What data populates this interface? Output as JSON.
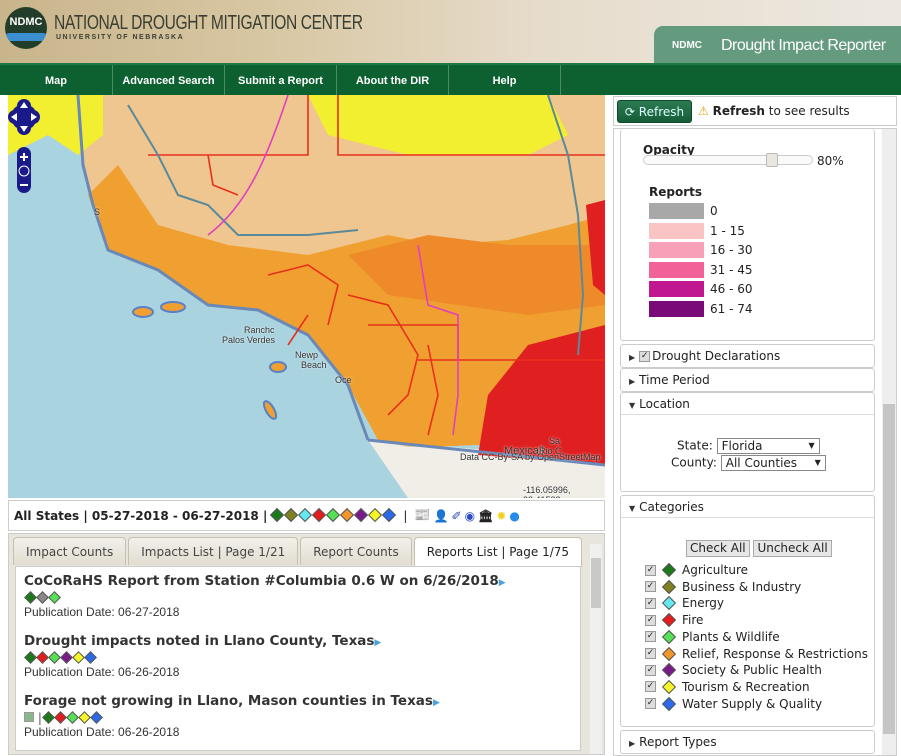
{
  "header": {
    "logo_text": "NDMC",
    "org_name": "NATIONAL DROUGHT MITIGATION CENTER",
    "university": "UNIVERSITY OF NEBRASKA",
    "app_short": "NDMC",
    "app_title": "Drought Impact Reporter"
  },
  "nav": [
    "Map",
    "Advanced Search",
    "Submit a Report",
    "About the DIR",
    "Help"
  ],
  "map": {
    "labels": {
      "ranchos": "Ranchc",
      "palos_verdes": "Palos Verdes",
      "newport": "Newp",
      "beach": "Beach",
      "oceanside": "Oce",
      "mexicali": "Mexicali",
      "rio": "Rio C",
      "san": "Sa",
      "s": "S"
    },
    "attribution": "Data CC-By-SA by OpenStreetMap",
    "coordinates": "-116.05996, 33.41588"
  },
  "filter": {
    "summary": "All States | 05-27-2018 - 06-27-2018 |",
    "category_colors": [
      "#1a7a1a",
      "#808020",
      "#66e8f0",
      "#e51c1c",
      "#55e055",
      "#f0962a",
      "#7a1a8a",
      "#f5f52a",
      "#2a6ae8"
    ],
    "separator": "|",
    "source_icons": [
      "news-icon",
      "person-icon",
      "cocorahs-icon",
      "noaa-icon",
      "government-icon",
      "sun-icon",
      "water-icon"
    ]
  },
  "tabs": [
    {
      "label": "Impact Counts"
    },
    {
      "label": "Impacts List | Page 1/21"
    },
    {
      "label": "Report Counts"
    },
    {
      "label": "Reports List | Page 1/75",
      "active": true
    }
  ],
  "reports": [
    {
      "title": "CoCoRaHS Report from Station #Columbia 0.6 W on 6/26/2018",
      "colors": [
        "#1a7a1a",
        "#888888",
        "#55e055"
      ],
      "pub": "Publication Date: 06-27-2018"
    },
    {
      "title": "Drought impacts noted in Llano County, Texas",
      "colors": [
        "#1a7a1a",
        "#e51c1c",
        "#55e055",
        "#7a1a8a",
        "#f5f52a",
        "#2a6ae8"
      ],
      "pub": "Publication Date: 06-26-2018"
    },
    {
      "title": "Forage not growing in Llano, Mason counties in Texas",
      "image": true,
      "colors": [
        "#1a7a1a",
        "#e51c1c",
        "#55e055",
        "#f5f52a",
        "#2a6ae8"
      ],
      "pub": "Publication Date: 06-26-2018"
    }
  ],
  "right": {
    "refresh_label": "Refresh",
    "refresh_bold": "Refresh",
    "refresh_msg": " to see results",
    "opacity_label": "Opacity",
    "opacity_value": "80%",
    "opacity_fraction": 0.8,
    "reports_label": "Reports",
    "legend": [
      {
        "label": "0",
        "color": "#a8a8a8"
      },
      {
        "label": "1 - 15",
        "color": "#fbc4c4"
      },
      {
        "label": "16 - 30",
        "color": "#f7a0b8"
      },
      {
        "label": "31 - 45",
        "color": "#f06298"
      },
      {
        "label": "46 - 60",
        "color": "#c01890"
      },
      {
        "label": "61 - 74",
        "color": "#7a0a78"
      }
    ],
    "sections": {
      "drought_declarations": "Drought Declarations",
      "time_period": "Time Period",
      "location": "Location",
      "categories": "Categories",
      "report_types": "Report Types"
    },
    "state_label": "State:",
    "state_value": "Florida",
    "county_label": "County:",
    "county_value": "All Counties",
    "check_all": "Check All",
    "uncheck_all": "Uncheck All",
    "categories": [
      {
        "label": "Agriculture",
        "color": "#1a7a1a"
      },
      {
        "label": "Business & Industry",
        "color": "#808020"
      },
      {
        "label": "Energy",
        "color": "#66e8f0"
      },
      {
        "label": "Fire",
        "color": "#e51c1c"
      },
      {
        "label": "Plants & Wildlife",
        "color": "#55e055"
      },
      {
        "label": "Relief, Response & Restrictions",
        "color": "#f0962a"
      },
      {
        "label": "Society & Public Health",
        "color": "#7a1a8a"
      },
      {
        "label": "Tourism & Recreation",
        "color": "#f5f52a"
      },
      {
        "label": "Water Supply & Quality",
        "color": "#2a6ae8"
      }
    ]
  }
}
